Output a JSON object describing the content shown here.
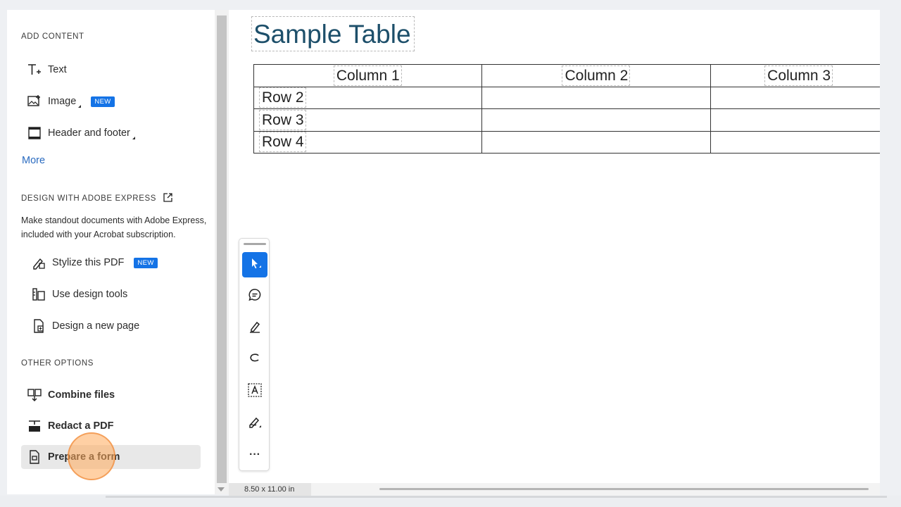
{
  "panel": {
    "add_content": {
      "title": "ADD CONTENT",
      "items": [
        {
          "label": "Text"
        },
        {
          "label": "Image",
          "badge": "NEW"
        },
        {
          "label": "Header and footer"
        }
      ],
      "more": "More"
    },
    "design": {
      "title": "DESIGN WITH ADOBE EXPRESS",
      "description": "Make standout documents with Adobe Express, included with your Acrobat subscription.",
      "items": [
        {
          "label": "Stylize this PDF",
          "badge": "NEW"
        },
        {
          "label": "Use design tools"
        },
        {
          "label": "Design a new page"
        }
      ]
    },
    "other": {
      "title": "OTHER OPTIONS",
      "items": [
        {
          "label": "Combine files"
        },
        {
          "label": "Redact a PDF"
        },
        {
          "label": "Prepare a form"
        }
      ]
    }
  },
  "document": {
    "title": "Sample Table",
    "table": {
      "headers": [
        "Column 1",
        "Column 2",
        "Column 3"
      ],
      "rows": [
        [
          "Row 2",
          "",
          ""
        ],
        [
          "Row 3",
          "",
          ""
        ],
        [
          "Row 4",
          "",
          ""
        ]
      ]
    }
  },
  "toolbar": {
    "tools": [
      "select-tool",
      "comment-tool",
      "highlight-tool",
      "draw-tool",
      "text-box-tool",
      "sign-tool",
      "more-tools"
    ],
    "more_label": "···"
  },
  "status": {
    "page_size": "8.50 x 11.00 in"
  },
  "colors": {
    "accent": "#1473e6",
    "link": "#2a6bc0",
    "title": "#1d4f6a"
  }
}
